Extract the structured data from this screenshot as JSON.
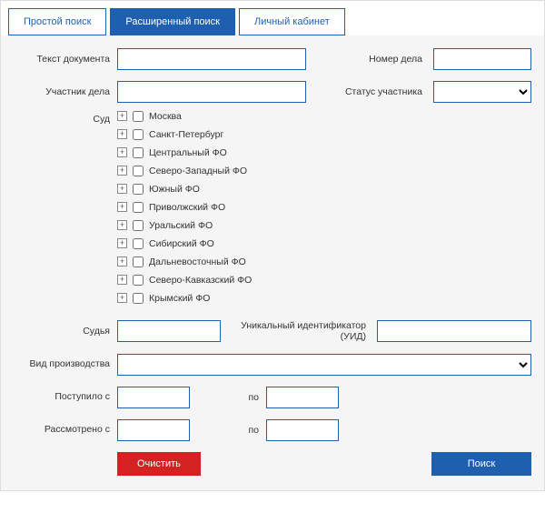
{
  "tabs": {
    "simple": "Простой поиск",
    "advanced": "Расширенный поиск",
    "cabinet": "Личный кабинет"
  },
  "labels": {
    "doc_text": "Текст документа",
    "case_num": "Номер дела",
    "participant": "Участник дела",
    "status": "Статус участника",
    "court": "Суд",
    "judge": "Судья",
    "uid": "Уникальный идентификатор (УИД)",
    "production": "Вид производства",
    "received_from": "Поступило с",
    "reviewed_from": "Рассмотрено с",
    "to": "по"
  },
  "courts": [
    "Москва",
    "Санкт-Петербург",
    "Центральный ФО",
    "Северо-Западный ФО",
    "Южный ФО",
    "Приволжский ФО",
    "Уральский ФО",
    "Сибирский ФО",
    "Дальневосточный ФО",
    "Северо-Кавказский ФО",
    "Крымский ФО"
  ],
  "values": {
    "doc_text": "",
    "case_num": "",
    "participant": "",
    "status": "",
    "judge": "",
    "uid": "",
    "production": "",
    "received_from": "",
    "received_to": "",
    "reviewed_from": "",
    "reviewed_to": ""
  },
  "buttons": {
    "clear": "Очистить",
    "search": "Поиск"
  }
}
